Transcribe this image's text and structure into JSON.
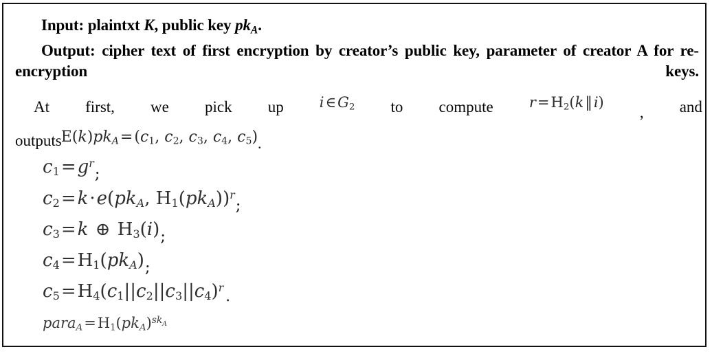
{
  "document": {
    "type": "algorithm-box",
    "border_color": "#111111",
    "background_color": "#ffffff",
    "text_color": "#000000",
    "math_color": "#2f2f2f"
  },
  "header": {
    "input_label": "Input:",
    "input_text_1": " plaintxt ",
    "input_var_k": "K",
    "input_text_2": ", public key ",
    "input_var_pk": "pk",
    "input_var_pk_sub": "A",
    "input_period": ".",
    "output_label": "Output:",
    "output_text": " cipher text of first encryption by creator’s public key, parameter of creator A for re-encryption keys."
  },
  "body": {
    "line1": {
      "w1": "At",
      "w2": "first,",
      "w3": "we",
      "w4": "pick",
      "w5": "up",
      "math_pick": {
        "var": "i",
        "op": "∈",
        "group": "G",
        "group_sub": "2",
        "full": "i ∈ G₂"
      },
      "w6": "to",
      "w7": "compute",
      "math_r": {
        "lhs": "r",
        "eq": "=",
        "fn": "H",
        "fn_sub": "2",
        "open": "(",
        "arg1": "k",
        "sep": "‖",
        "arg2": "i",
        "close": ")",
        "full": "r = H₂(k ‖ i)"
      },
      "comma": ",",
      "w8": "and"
    },
    "line2": {
      "w1": "outputs",
      "math_enc": {
        "fn": "E",
        "open1": "(",
        "arg": "k",
        "close1": ")",
        "pk": "pk",
        "pk_sub": "A",
        "eq": "=",
        "open2": "(",
        "c1": "c",
        "c1_sub": "1",
        "c2": "c",
        "c2_sub": "2",
        "c3": "c",
        "c3_sub": "3",
        "c4": "c",
        "c4_sub": "4",
        "c5": "c",
        "c5_sub": "5",
        "close2": ")",
        "full": "E(k)pk_A = (c₁, c₂, c₃, c₄, c₅)"
      },
      "period": "."
    }
  },
  "equations": [
    {
      "name": "c1",
      "latex": "c_1 = g^r",
      "plain": "c₁ = gʳ ;",
      "terminator": ";"
    },
    {
      "name": "c2",
      "latex": "c_2 = k \\cdot e(pk_A, H_1(pk_A))^r",
      "plain": "c₂ = k · e(pk_A, H₁(pk_A))ʳ ;",
      "terminator": ";"
    },
    {
      "name": "c3",
      "latex": "c_3 = k \\oplus H_3(i)",
      "plain": "c₃ = k ⊕ H₃(i) ;",
      "terminator": ";"
    },
    {
      "name": "c4",
      "latex": "c_4 = H_1(pk_A)",
      "plain": "c₄ = H₁(pk_A) ;",
      "terminator": ";"
    },
    {
      "name": "c5",
      "latex": "c_5 = H_4(c_1||c_2||c_3||c_4)^r",
      "plain": "c₅ = H₄(c₁||c₂||c₃||c₄)ʳ .",
      "terminator": "."
    },
    {
      "name": "para_A",
      "latex": "para_A = H_1(pk_A)^{sk_A}",
      "plain": "para_A = H₁(pk_A)^{sk_A}",
      "terminator": ""
    }
  ],
  "symbols": {
    "c": "c",
    "g": "g",
    "k": "k",
    "i": "i",
    "r": "r",
    "e": "e",
    "H": "H",
    "E": "E",
    "A": "A",
    "pk": "pk",
    "sk": "sk",
    "para": "para",
    "equals": "=",
    "cdot": "·",
    "oplus": "⊕",
    "elem": "∈",
    "dbar": "‖",
    "bars": "||",
    "comma": ",",
    "lparen": "(",
    "rparen": ")",
    "G": "G"
  }
}
